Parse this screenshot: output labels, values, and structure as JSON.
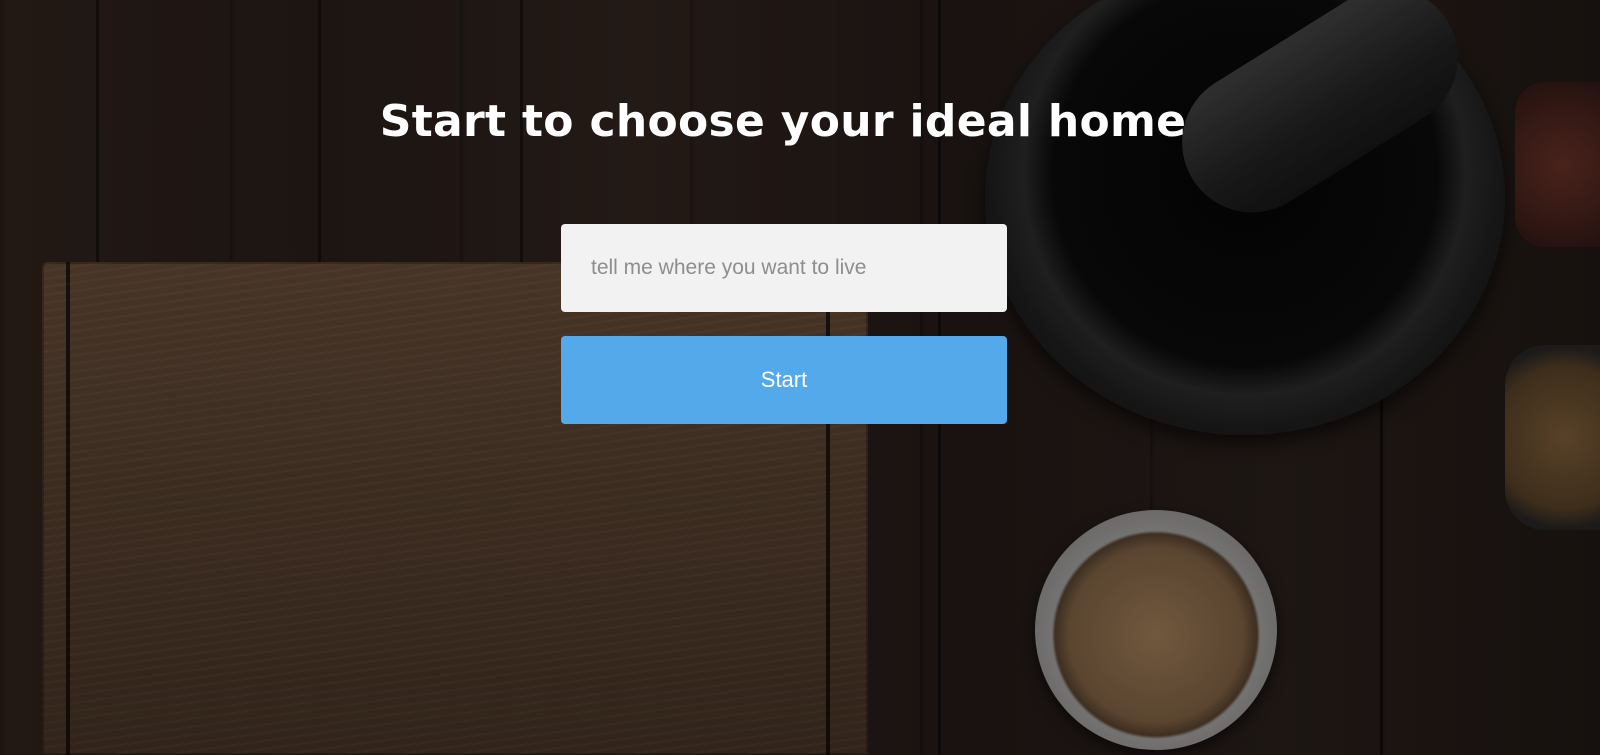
{
  "hero": {
    "title": "Start to choose your ideal home",
    "search": {
      "value": "",
      "placeholder": "tell me where you want to live"
    },
    "start_label": "Start"
  },
  "colors": {
    "button_accent": "#53a9e9",
    "input_background": "#f2f2f2",
    "title_text": "#ffffff"
  },
  "background": {
    "description_icons": [
      "cutting-board",
      "mortar-and-pestle",
      "spice-bowl",
      "spice-jar"
    ]
  }
}
